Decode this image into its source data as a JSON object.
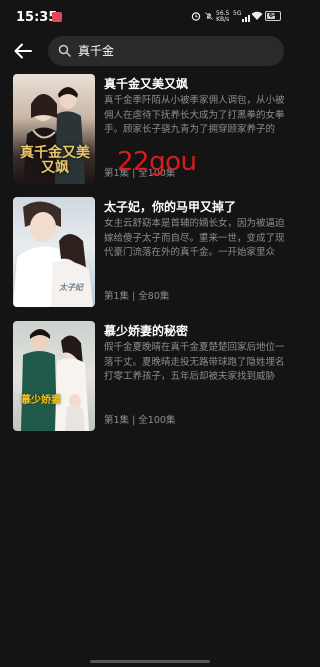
{
  "status_bar": {
    "time": "15:35",
    "speed_value": "56.5",
    "speed_unit": "KB/s",
    "network": "5G",
    "battery": "64"
  },
  "search": {
    "query": "真千金"
  },
  "watermark": "22gou",
  "results": [
    {
      "title": "真千金又美又飒",
      "description": "真千金季阡陌从小被季家佣人调包，从小被佣人在虐待下抚养长大成为了打黑拳的女拳手。顾家长子骁九青为了拥穿顾家养子的",
      "episodes": "第1集 | 全100集",
      "poster_caption": "真千金又美又飒"
    },
    {
      "title": "太子妃，你的马甲又掉了",
      "description": "女主云舒窈本是首辅的嫡长女，因为被逼迫嫁给傻子太子而自尽。重来一世，变成了现代豪门流落在外的真千金。一开始家里众",
      "episodes": "第1集 | 全80集",
      "poster_caption": "太子妃"
    },
    {
      "title": "慕少娇妻的秘密",
      "description": "假千金夏晚晴在真千金夏楚楚回家后地位一落千丈。夏晚晴走投无路带球跑了隐姓埋名打零工养孩子，五年后却被夫家找到威胁",
      "episodes": "第1集 | 全100集",
      "poster_caption": "慕少娇妻"
    }
  ],
  "icons": {
    "back": "arrow-left-icon",
    "search": "magnifier-icon"
  }
}
